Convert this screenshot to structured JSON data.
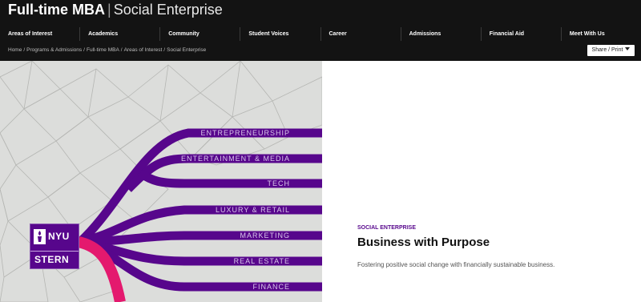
{
  "header": {
    "title_bold": "Full-time MBA",
    "title_separator": "|",
    "title_light": "Social Enterprise"
  },
  "nav": {
    "items": [
      {
        "label": "Areas of Interest"
      },
      {
        "label": "Academics"
      },
      {
        "label": "Community"
      },
      {
        "label": "Student Voices"
      },
      {
        "label": "Career"
      },
      {
        "label": "Admissions"
      },
      {
        "label": "Financial Aid"
      },
      {
        "label": "Meet With Us"
      }
    ]
  },
  "breadcrumb": {
    "items": [
      "Home",
      "Programs & Admissions",
      "Full-time MBA",
      "Areas of Interest",
      "Social Enterprise"
    ]
  },
  "share_button": {
    "label": "Share / Print",
    "icon": "caret-down-icon"
  },
  "hero": {
    "branches": [
      "ENTREPRENEURSHIP",
      "ENTERTAINMENT & MEDIA",
      "TECH",
      "LUXURY & RETAIL",
      "MARKETING",
      "REAL ESTATE",
      "FINANCE"
    ],
    "logo_top": "NYU",
    "logo_bottom": "STERN",
    "colors": {
      "purple": "#57068c",
      "pink": "#e4196e",
      "background": "#dcdddb"
    }
  },
  "content": {
    "eyebrow": "SOCIAL ENTERPRISE",
    "title": "Business with Purpose",
    "description": "Fostering positive social change with financially sustainable business."
  }
}
